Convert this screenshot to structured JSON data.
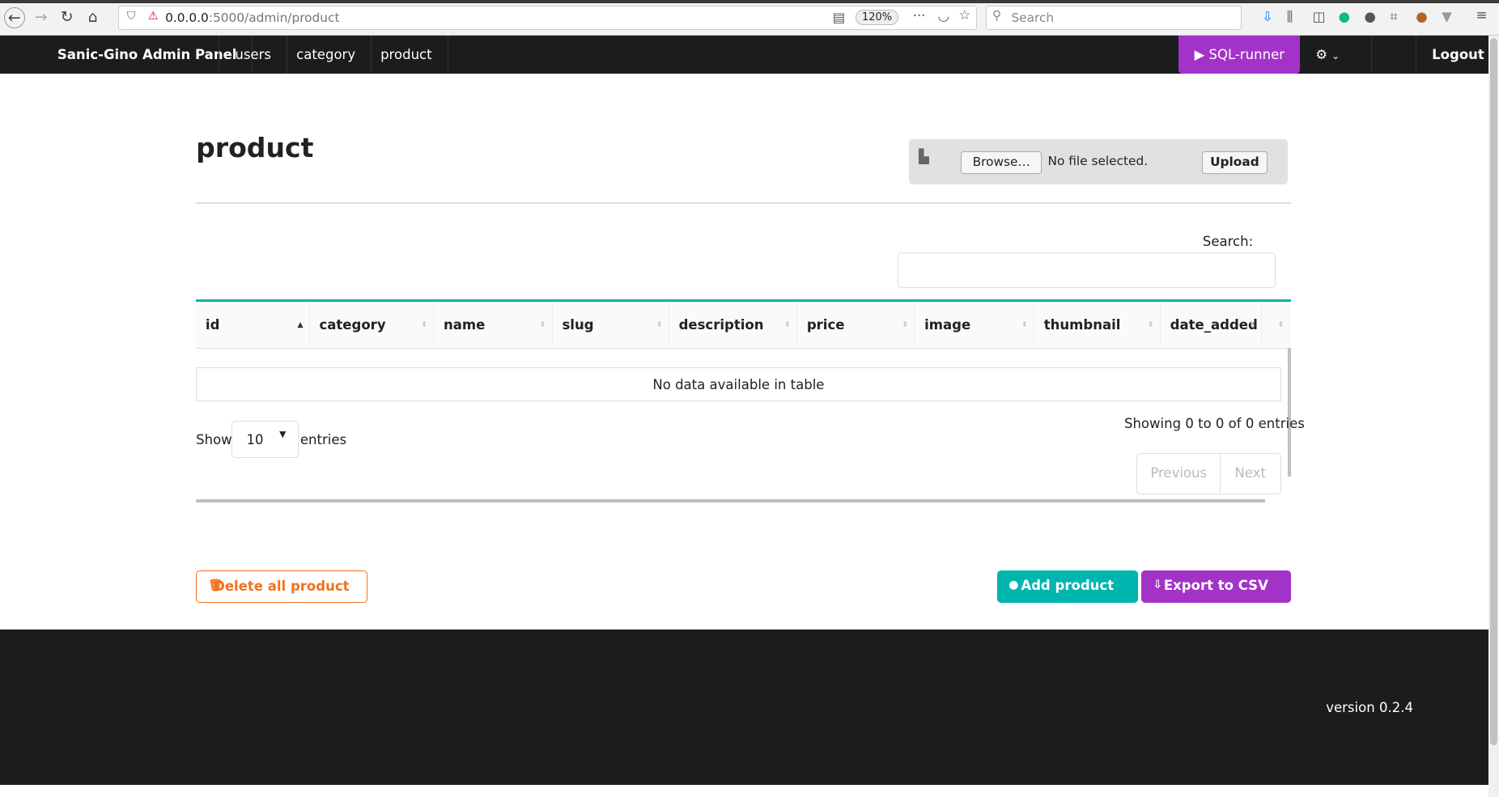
{
  "browser": {
    "url_host": "0.0.0.0",
    "url_path": ":5000/admin/product",
    "zoom": "120%",
    "search_placeholder": "Search"
  },
  "nav": {
    "brand": "Sanic-Gino Admin Panel",
    "items": [
      "users",
      "category",
      "product"
    ],
    "sql_runner": "SQL-runner",
    "logout": "Logout"
  },
  "page": {
    "title": "product"
  },
  "upload": {
    "browse": "Browse…",
    "status": "No file selected.",
    "upload": "Upload"
  },
  "table": {
    "search_label": "Search:",
    "columns": [
      "id",
      "category",
      "name",
      "slug",
      "description",
      "price",
      "image",
      "thumbnail",
      "date_added"
    ],
    "empty": "No data available in table",
    "show": "Show",
    "page_size": "10",
    "entries": "entries",
    "info": "Showing 0 to 0 of 0 entries",
    "previous": "Previous",
    "next": "Next"
  },
  "actions": {
    "delete": "Delete all product",
    "add": "Add product",
    "export": "Export to CSV"
  },
  "footer": {
    "version": "version 0.2.4"
  },
  "colors": {
    "teal": "#00b5ad",
    "purple": "#a333c8",
    "orange": "#f2711c",
    "dark": "#1b1c1d"
  }
}
